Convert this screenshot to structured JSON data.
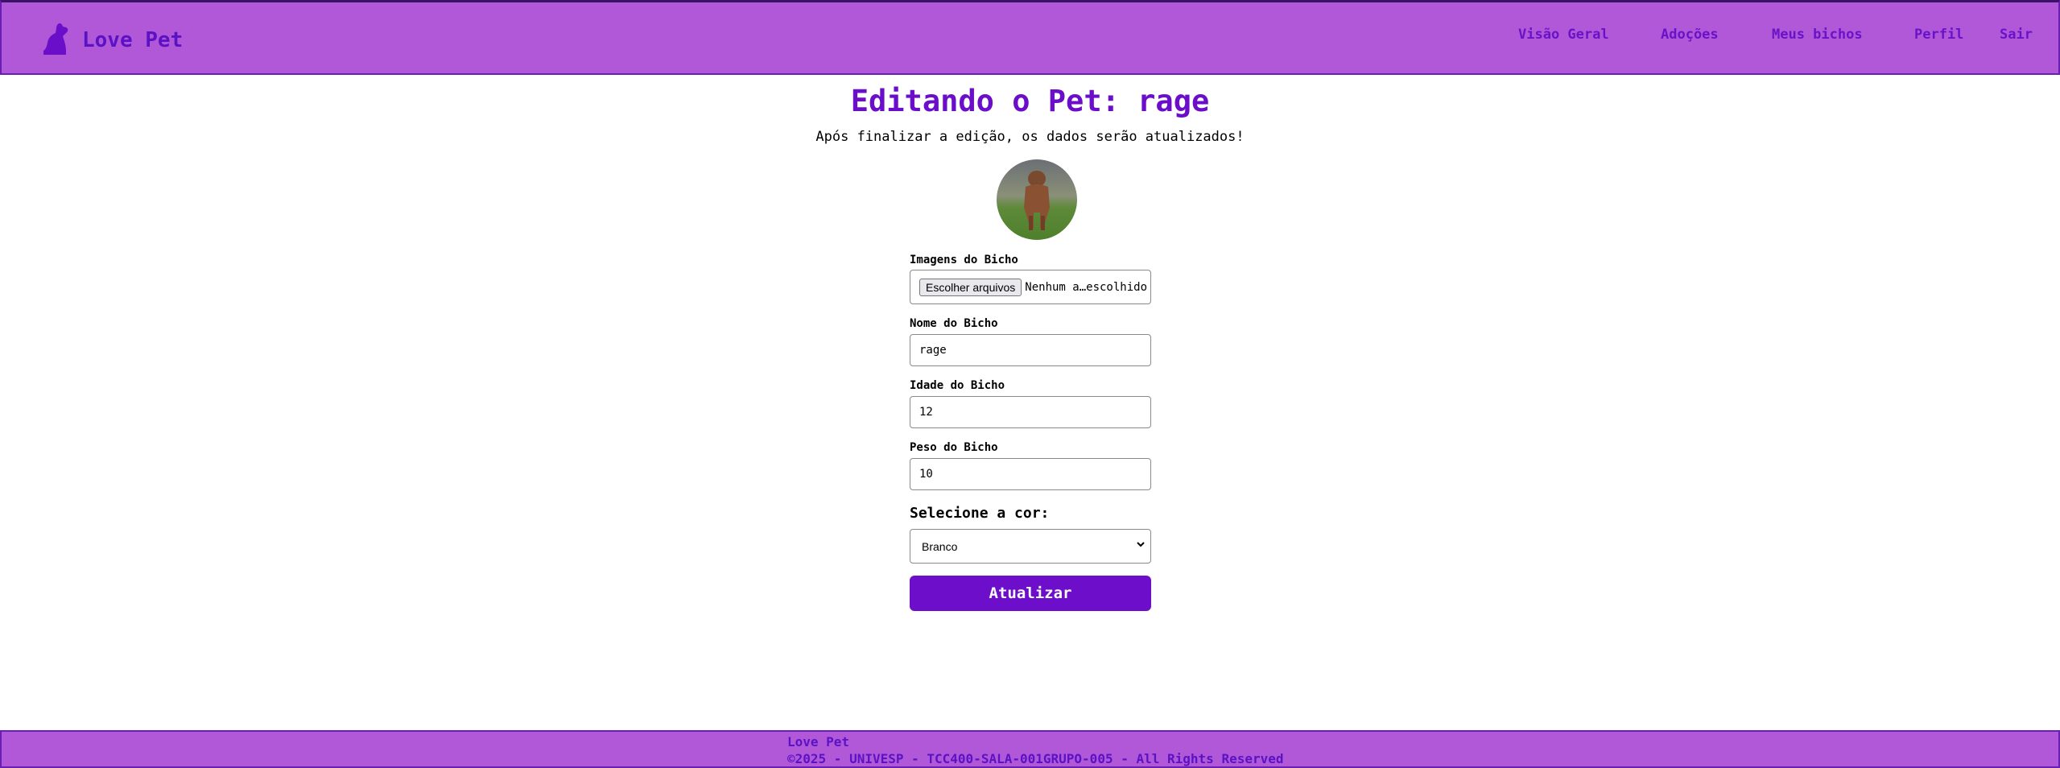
{
  "navbar": {
    "brand": "Love Pet",
    "brand_icon": "dog-icon",
    "links": [
      {
        "label": "Visão Geral"
      },
      {
        "label": "Adoções"
      },
      {
        "label": "Meus bichos"
      },
      {
        "label": "Perfil"
      },
      {
        "label": "Sair"
      }
    ]
  },
  "page": {
    "title": "Editando o Pet: rage",
    "subtitle": "Após finalizar a edição, os dados serão atualizados!"
  },
  "form": {
    "images_label": "Imagens do Bicho",
    "file_button": "Escolher arquivos",
    "file_status": "Nenhum a…escolhido",
    "name_label": "Nome do Bicho",
    "name_value": "rage",
    "age_label": "Idade do Bicho",
    "age_value": "12",
    "weight_label": "Peso do Bicho",
    "weight_value": "10",
    "color_heading": "Selecione a cor:",
    "color_value": "Branco",
    "submit": "Atualizar"
  },
  "footer": {
    "line1": "Love Pet",
    "line2": "©2025 - UNIVESP - TCC400-SALA-001GRUPO-005 - All Rights Reserved"
  },
  "colors": {
    "navbar_bg": "#b058d8",
    "accent": "#6a0ec9",
    "button_bg": "#6d0ecb"
  }
}
